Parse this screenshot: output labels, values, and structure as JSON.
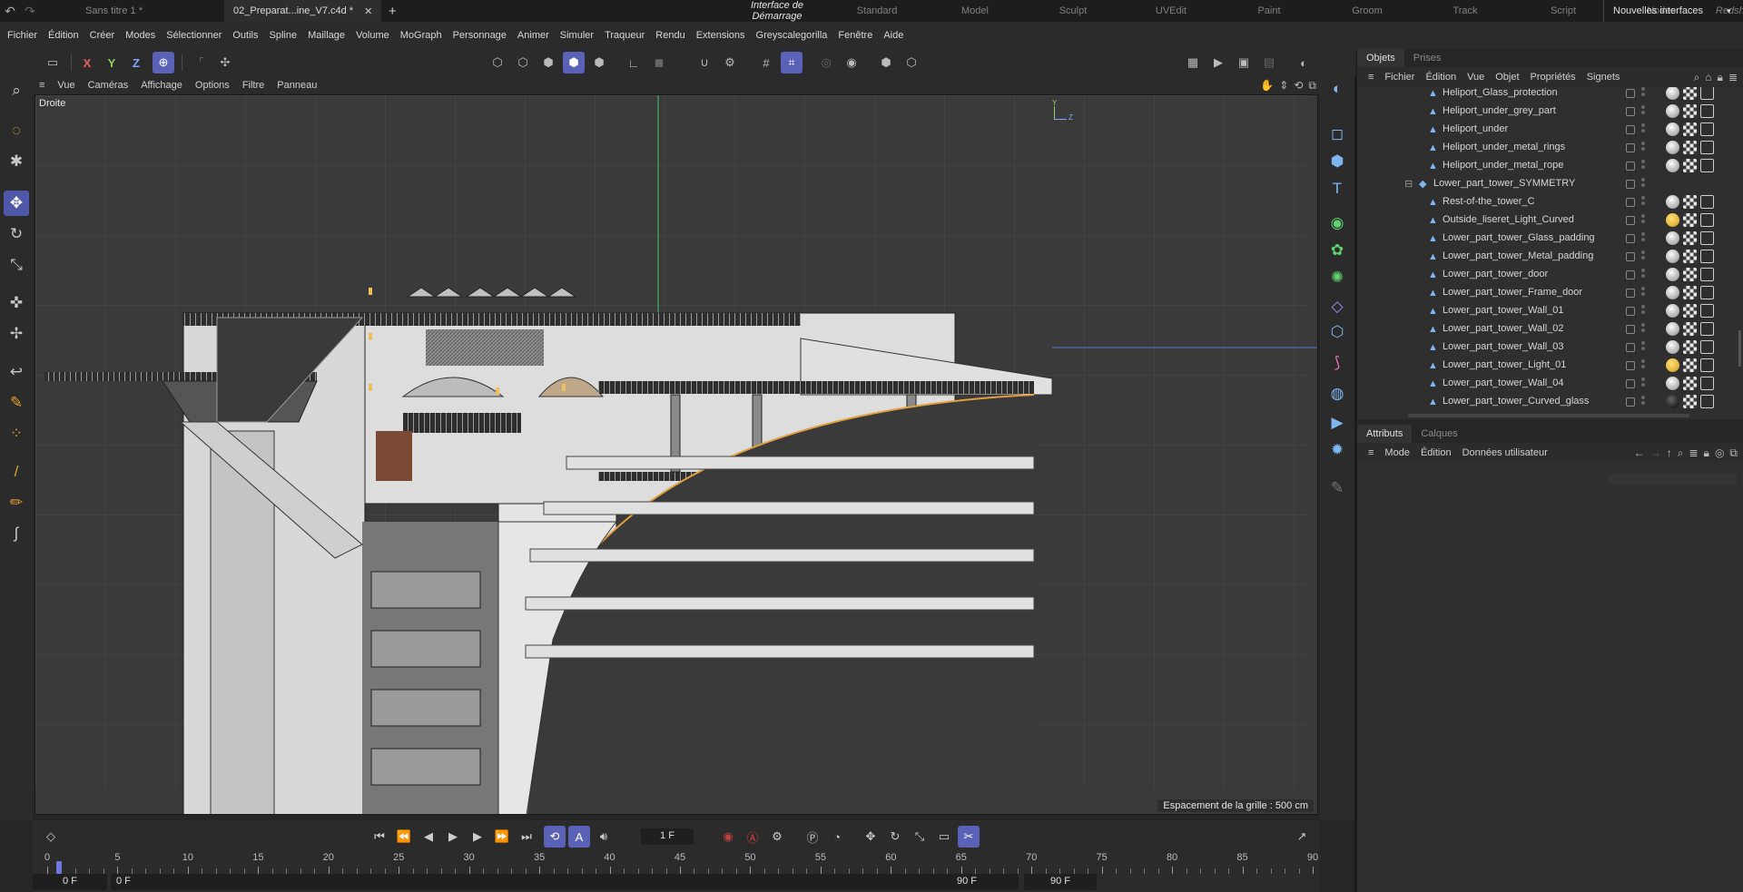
{
  "titlebar": {
    "tabs": [
      {
        "label": "Sans titre 1 *",
        "active": false
      },
      {
        "label": "02_Preparat...ine_V7.c4d *",
        "active": true
      }
    ],
    "layouts": [
      "Interface de Démarrage",
      "Standard",
      "Model",
      "Sculpt",
      "UVEdit",
      "Paint",
      "Groom",
      "Track",
      "Script",
      "Nodes",
      "Redshift Interface"
    ],
    "active_layout": "Interface de Démarrage",
    "new_interfaces": "Nouvelles interfaces"
  },
  "menubar": [
    "Fichier",
    "Édition",
    "Créer",
    "Modes",
    "Sélectionner",
    "Outils",
    "Spline",
    "Maillage",
    "Volume",
    "MoGraph",
    "Personnage",
    "Animer",
    "Simuler",
    "Traqueur",
    "Rendu",
    "Extensions",
    "Greyscalegorilla",
    "Fenêtre",
    "Aide"
  ],
  "toolbar": {
    "axis_x": "X",
    "axis_y": "Y",
    "axis_z": "Z"
  },
  "viewport": {
    "menus": [
      "Vue",
      "Caméras",
      "Affichage",
      "Options",
      "Filtre",
      "Panneau"
    ],
    "label": "Droite",
    "grid_note": "Espacement de la grille : 500 cm",
    "axis_y": "Y",
    "axis_z": "Z"
  },
  "object_manager": {
    "tabs": [
      "Objets",
      "Prises"
    ],
    "menus": [
      "Fichier",
      "Édition",
      "Vue",
      "Objet",
      "Propriétés",
      "Signets"
    ],
    "rows": [
      {
        "name": "Heliport_Glass_protection",
        "indent": 2
      },
      {
        "name": "Heliport_under_grey_part",
        "indent": 2
      },
      {
        "name": "Heliport_under",
        "indent": 2
      },
      {
        "name": "Heliport_under_metal_rings",
        "indent": 2
      },
      {
        "name": "Heliport_under_metal_rope",
        "indent": 2
      },
      {
        "name": "Lower_part_tower_SYMMETRY",
        "indent": 1,
        "group": true
      },
      {
        "name": "Rest-of-the_tower_C",
        "indent": 2
      },
      {
        "name": "Outside_liseret_Light_Curved",
        "indent": 2
      },
      {
        "name": "Lower_part_tower_Glass_padding",
        "indent": 2
      },
      {
        "name": "Lower_part_tower_Metal_padding",
        "indent": 2
      },
      {
        "name": "Lower_part_tower_door",
        "indent": 2
      },
      {
        "name": "Lower_part_tower_Frame_door",
        "indent": 2
      },
      {
        "name": "Lower_part_tower_Wall_01",
        "indent": 2
      },
      {
        "name": "Lower_part_tower_Wall_02",
        "indent": 2
      },
      {
        "name": "Lower_part_tower_Wall_03",
        "indent": 2
      },
      {
        "name": "Lower_part_tower_Light_01",
        "indent": 2
      },
      {
        "name": "Lower_part_tower_Wall_04",
        "indent": 2
      },
      {
        "name": "Lower_part_tower_Curved_glass",
        "indent": 2
      }
    ]
  },
  "attributes": {
    "tabs": [
      "Attributs",
      "Calques"
    ],
    "menus": [
      "Mode",
      "Édition",
      "Données utilisateur"
    ]
  },
  "timeline": {
    "current_frame": "1 F",
    "start_field": "0 F",
    "start_field2": "0 F",
    "end_field": "90 F",
    "end_field2": "90 F",
    "ruler_labels": [
      "0",
      "5",
      "10",
      "15",
      "20",
      "25",
      "30",
      "35",
      "40",
      "45",
      "50",
      "55",
      "60",
      "65",
      "70",
      "75",
      "80",
      "85",
      "90"
    ]
  },
  "colors": {
    "accent": "#5a62b8",
    "bg": "#262626",
    "panel": "#2b2b2b"
  }
}
